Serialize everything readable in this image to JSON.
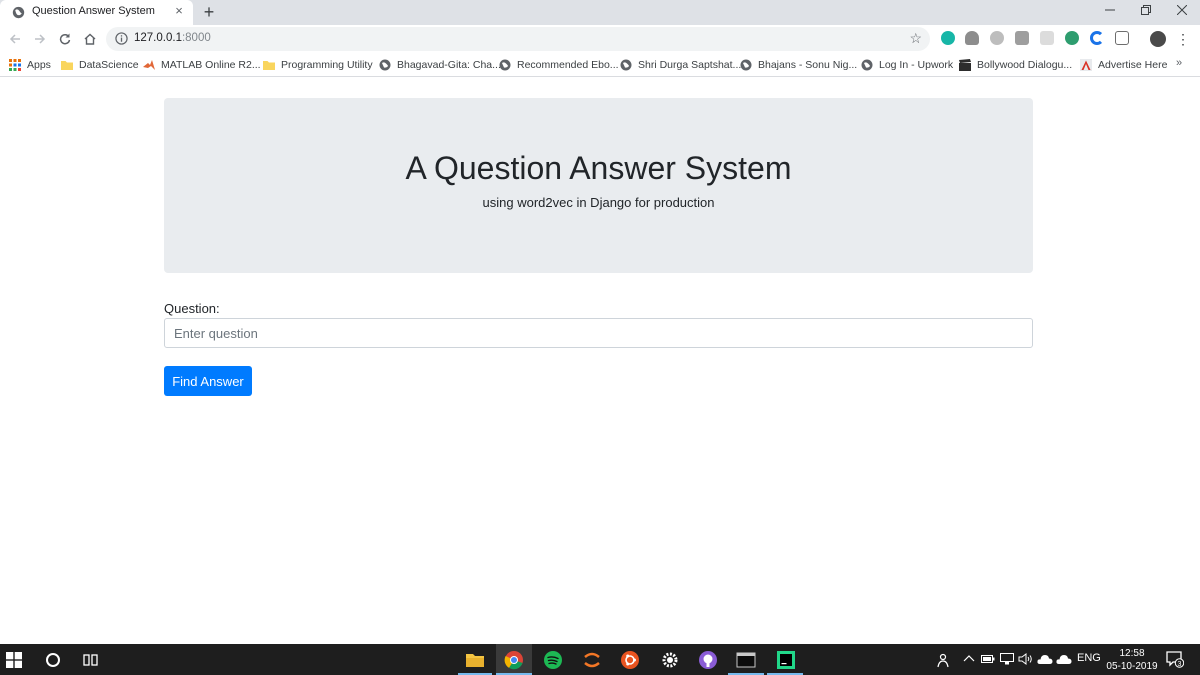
{
  "browser": {
    "tab_title": "Question Answer System",
    "tab_close": "×",
    "new_tab": "+",
    "url_host": "127.0.0.1",
    "url_port": ":8000",
    "bookmarks": [
      {
        "label": "Apps",
        "icon": "apps-grid-icon"
      },
      {
        "label": "DataScience",
        "icon": "folder-icon"
      },
      {
        "label": "MATLAB Online R2...",
        "icon": "matlab-icon"
      },
      {
        "label": "Programming Utility",
        "icon": "folder-icon"
      },
      {
        "label": "Bhagavad-Gita: Cha...",
        "icon": "globe-icon"
      },
      {
        "label": "Recommended Ebo...",
        "icon": "globe-icon"
      },
      {
        "label": "Shri Durga Saptshat...",
        "icon": "globe-icon"
      },
      {
        "label": "Bhajans - Sonu Nig...",
        "icon": "globe-icon"
      },
      {
        "label": "Log In - Upwork",
        "icon": "globe-icon"
      },
      {
        "label": "Bollywood Dialogu...",
        "icon": "clapperboard-icon"
      },
      {
        "label": "Advertise Here",
        "icon": "adobe-icon"
      }
    ],
    "more_bookmarks": "»"
  },
  "page": {
    "heading": "A Question Answer System",
    "subheading": "using word2vec in Django for production",
    "question_label": "Question:",
    "question_placeholder": "Enter question",
    "question_value": "",
    "submit_label": "Find Answer"
  },
  "taskbar": {
    "language": "ENG",
    "time": "12:58",
    "date": "05-10-2019",
    "notification_count": "3"
  },
  "colors": {
    "primary": "#007bff",
    "jumbotron_bg": "#e9ecef",
    "taskbar_bg": "#1e1e1e",
    "tabstrip_bg": "#dee1e6"
  }
}
